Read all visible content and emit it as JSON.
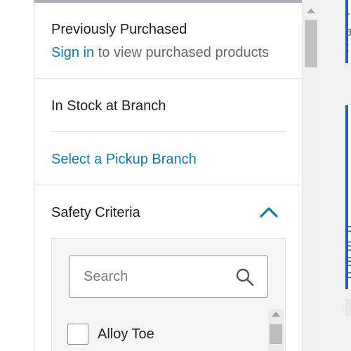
{
  "previously_purchased": {
    "title": "Previously Purchased",
    "sign_in_link": "Sign in",
    "sign_in_suffix": " to view purchased products"
  },
  "stock": {
    "title": "In Stock at Branch",
    "pickup_link": "Select a Pickup Branch"
  },
  "safety": {
    "title": "Safety Criteria",
    "search_placeholder": "Search",
    "options": [
      {
        "label": "Alloy Toe",
        "checked": false
      }
    ]
  },
  "right_cards": {
    "card1_text": "r\na\nt",
    "card2_text": "R\nS\nS\nR"
  },
  "colors": {
    "link": "#0f7ba3",
    "card_accent": "#1f5db8"
  }
}
